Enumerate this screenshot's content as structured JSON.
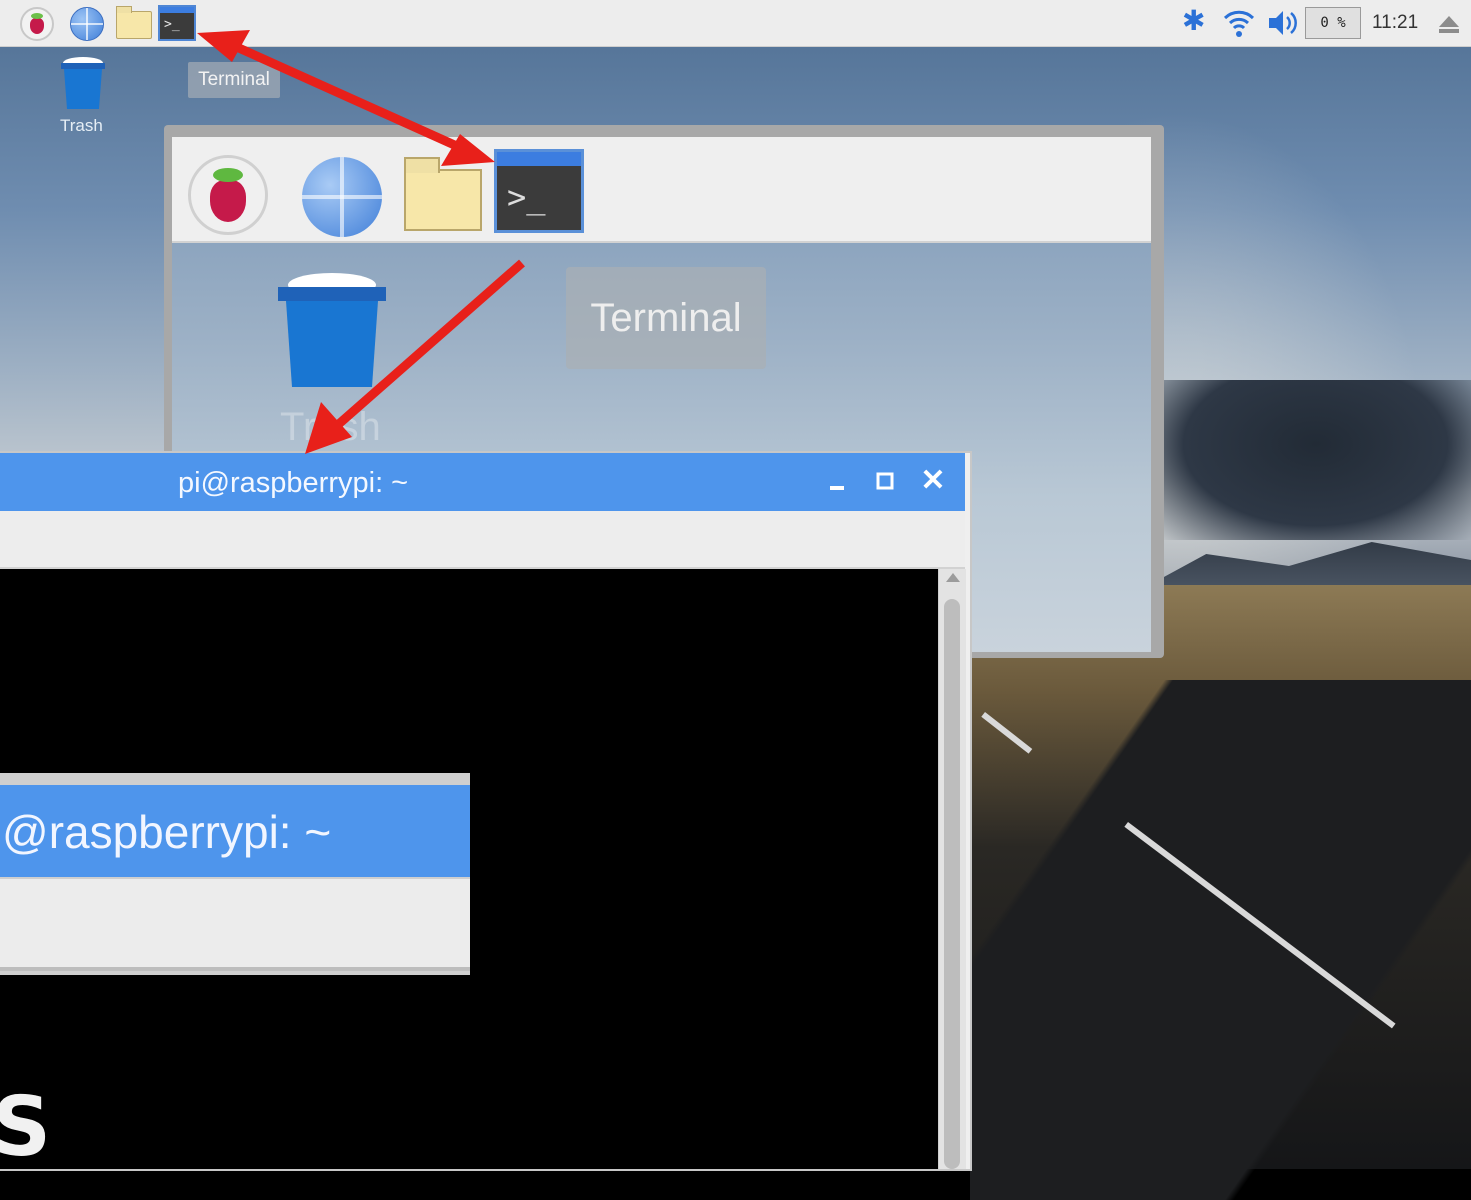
{
  "taskbar": {
    "launchers": [
      "raspberry-pi-menu",
      "web-browser",
      "file-manager",
      "terminal"
    ],
    "terminal_glyph": ">_",
    "cpu_usage": "0 %",
    "clock": "11:21"
  },
  "desktop": {
    "trash_label": "Trash",
    "tooltip": "Terminal"
  },
  "zoom_panel": {
    "terminal_glyph": ">_",
    "trash_label": "Trash",
    "tooltip": "Terminal"
  },
  "terminal_window": {
    "title": "pi@raspberrypi: ~",
    "minimize_label": "_",
    "close_label": "✕"
  },
  "title_zoom": {
    "title": "@raspberrypi: ~"
  },
  "overlay_glyph": "S",
  "colors": {
    "titlebar": "#4e95ec",
    "arrow": "#e8201a",
    "taskbar": "#ededed"
  }
}
